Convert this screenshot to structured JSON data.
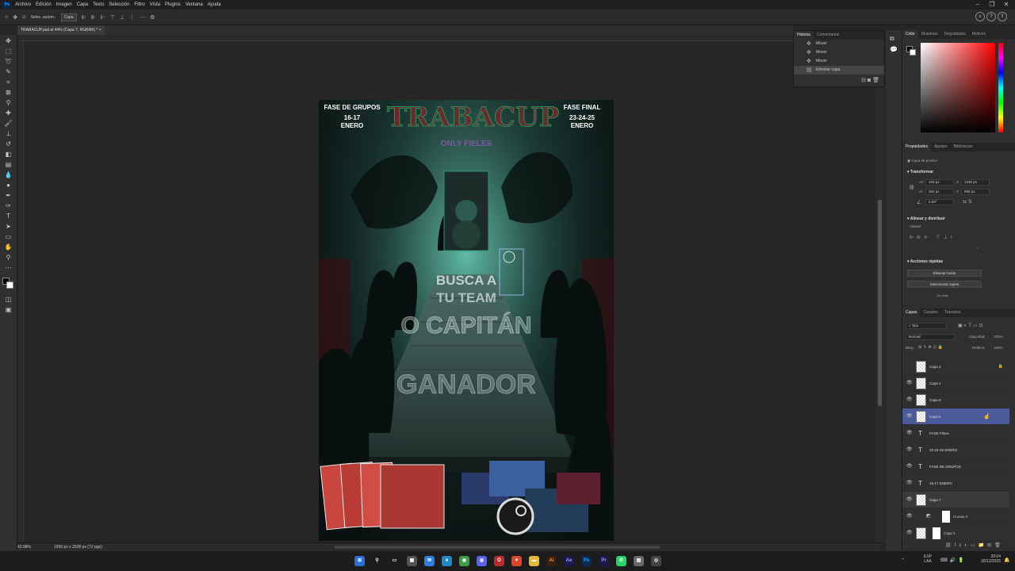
{
  "menubar": {
    "logo": "Ps",
    "items": [
      "Archivo",
      "Edición",
      "Imagen",
      "Capa",
      "Texto",
      "Selección",
      "Filtro",
      "Vista",
      "Plugins",
      "Ventana",
      "Ayuda"
    ]
  },
  "options": {
    "autoselect": "Selec. autom.:",
    "target": "Capa"
  },
  "document": {
    "tab_title": "TRABACUP.psd al 44% (Capa 7, RGB/8#) *",
    "zoom": "43.98%",
    "size": "1696 px x 2528 px (72 ppp)"
  },
  "poster": {
    "left_title": "FASE DE GRUPOS",
    "left_dates": "16-17",
    "left_month": "ENERO",
    "right_title": "FASE FINAL",
    "right_dates": "23-24-25",
    "right_month": "ENERO",
    "logo": "TRABACUP",
    "subtitle": "ONLY FIELES",
    "line1": "BUSCA A",
    "line2": "TU TEAM",
    "line3": "O CAPITÁN",
    "line4": "GANADOR"
  },
  "history": {
    "tabs": [
      "Historia",
      "Comentarios"
    ],
    "items": [
      "Mover",
      "Mover",
      "Mover",
      "Eliminar capa"
    ]
  },
  "color": {
    "tabs": [
      "Color",
      "Muestras",
      "Degradados",
      "Motivos"
    ],
    "hue": "#ff0000"
  },
  "properties": {
    "tabs": [
      "Propiedades",
      "Ajustes",
      "Bibliotecas"
    ],
    "layer_kind": "Capa de píxeles",
    "transform": "Transformar",
    "an_label": "An",
    "an": "153 px",
    "x_label": "X",
    "x": "1030 px",
    "al_label": "Al",
    "al": "264 px",
    "y_label": "Y",
    "y": "858 px",
    "angle": "0,00°",
    "align": "Alinear y distribuir",
    "align_sub": "Alinear:",
    "quick": "Acciones rápidas",
    "btn_remove_bg": "Eliminar fondo",
    "btn_select_subject": "Seleccionar sujeto",
    "more": "Ver más"
  },
  "layers": {
    "tabs": [
      "Capas",
      "Canales",
      "Trazados"
    ],
    "filter": "Tipo",
    "blend": "Normal",
    "opacity_label": "Opacidad:",
    "opacity": "100%",
    "lock_label": "Bloq.:",
    "fill_label": "Relleno:",
    "fill": "100%",
    "items": [
      {
        "name": "Capa 2",
        "kind": "pixel"
      },
      {
        "name": "Capa 1",
        "kind": "pixel"
      },
      {
        "name": "Capa 5",
        "kind": "pixel"
      },
      {
        "name": "Capa 6",
        "kind": "pixel"
      },
      {
        "name": "FASE FINAL",
        "kind": "text"
      },
      {
        "name": "23-24-25 ENERO",
        "kind": "text"
      },
      {
        "name": "FASE DE GRUPOS",
        "kind": "text"
      },
      {
        "name": "16-17 ENERO",
        "kind": "text"
      },
      {
        "name": "Capa 7",
        "kind": "pixel"
      },
      {
        "name": "Curvas 3",
        "kind": "adjust"
      },
      {
        "name": "Capa 3",
        "kind": "pixel"
      }
    ]
  },
  "taskbar": {
    "lang1": "ESP",
    "lang2": "LAA",
    "time": "20:04",
    "date": "30/12/2025"
  }
}
